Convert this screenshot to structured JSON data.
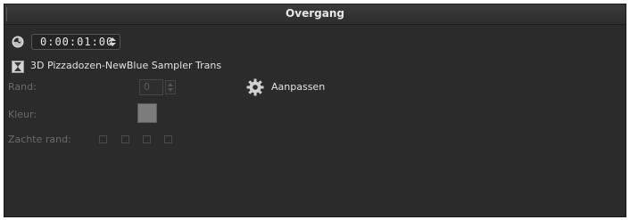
{
  "panel": {
    "title": "Overgang"
  },
  "duration": {
    "icon": "clock-icon",
    "timecode": "0:00:01:00"
  },
  "transition": {
    "icon": "hourglass-icon",
    "name": "3D Pizzadozen-NewBlue Sampler Trans"
  },
  "border": {
    "label": "Rand:",
    "value": "0"
  },
  "color": {
    "label": "Kleur:",
    "swatch": "#7c7c7c"
  },
  "soft_edge": {
    "label": "Zachte rand:",
    "options_count": 4
  },
  "customize": {
    "icon": "gear-icon",
    "label": "Aanpassen"
  }
}
